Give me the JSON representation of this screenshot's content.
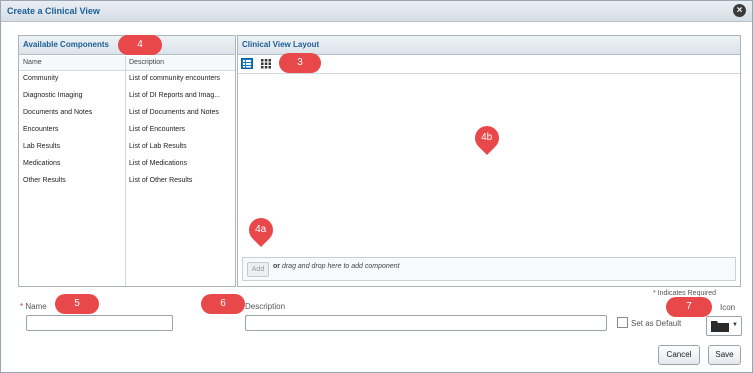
{
  "dialog": {
    "title": "Create a Clinical View",
    "close_icon": "close-icon"
  },
  "available_components": {
    "title": "Available Components",
    "columns": {
      "name": "Name",
      "description": "Description"
    },
    "rows": [
      {
        "name": "Community",
        "description": "List of community encounters"
      },
      {
        "name": "Diagnostic Imaging",
        "description": "List of DI Reports and Imag..."
      },
      {
        "name": "Documents and Notes",
        "description": "List of Documents and Notes"
      },
      {
        "name": "Encounters",
        "description": "List of Encounters"
      },
      {
        "name": "Lab Results",
        "description": "List of Lab Results"
      },
      {
        "name": "Medications",
        "description": "List of Medications"
      },
      {
        "name": "Other Results",
        "description": "List of Other Results"
      }
    ]
  },
  "layout_panel": {
    "title": "Clinical View Layout",
    "tools": [
      "list-view-icon",
      "grid-view-icon"
    ],
    "add_label": "Add",
    "add_hint_or": "or",
    "add_hint_text": "drag and drop here to add component"
  },
  "form": {
    "required_note": "* Indicates Required",
    "name_label": "Name",
    "name_value": "",
    "description_label": "Description",
    "description_value": "",
    "default_label": "Set as Default",
    "default_checked": false,
    "icon_label": "Icon",
    "icon_value": "folder-icon"
  },
  "buttons": {
    "cancel": "Cancel",
    "save": "Save"
  },
  "callouts": {
    "c3": "3",
    "c4": "4",
    "c4a": "4a",
    "c4b": "4b",
    "c5": "5",
    "c6": "6",
    "c7": "7"
  },
  "colors": {
    "accent": "#1b5e97",
    "callout": "#e8484a",
    "required": "#c43b3b"
  }
}
